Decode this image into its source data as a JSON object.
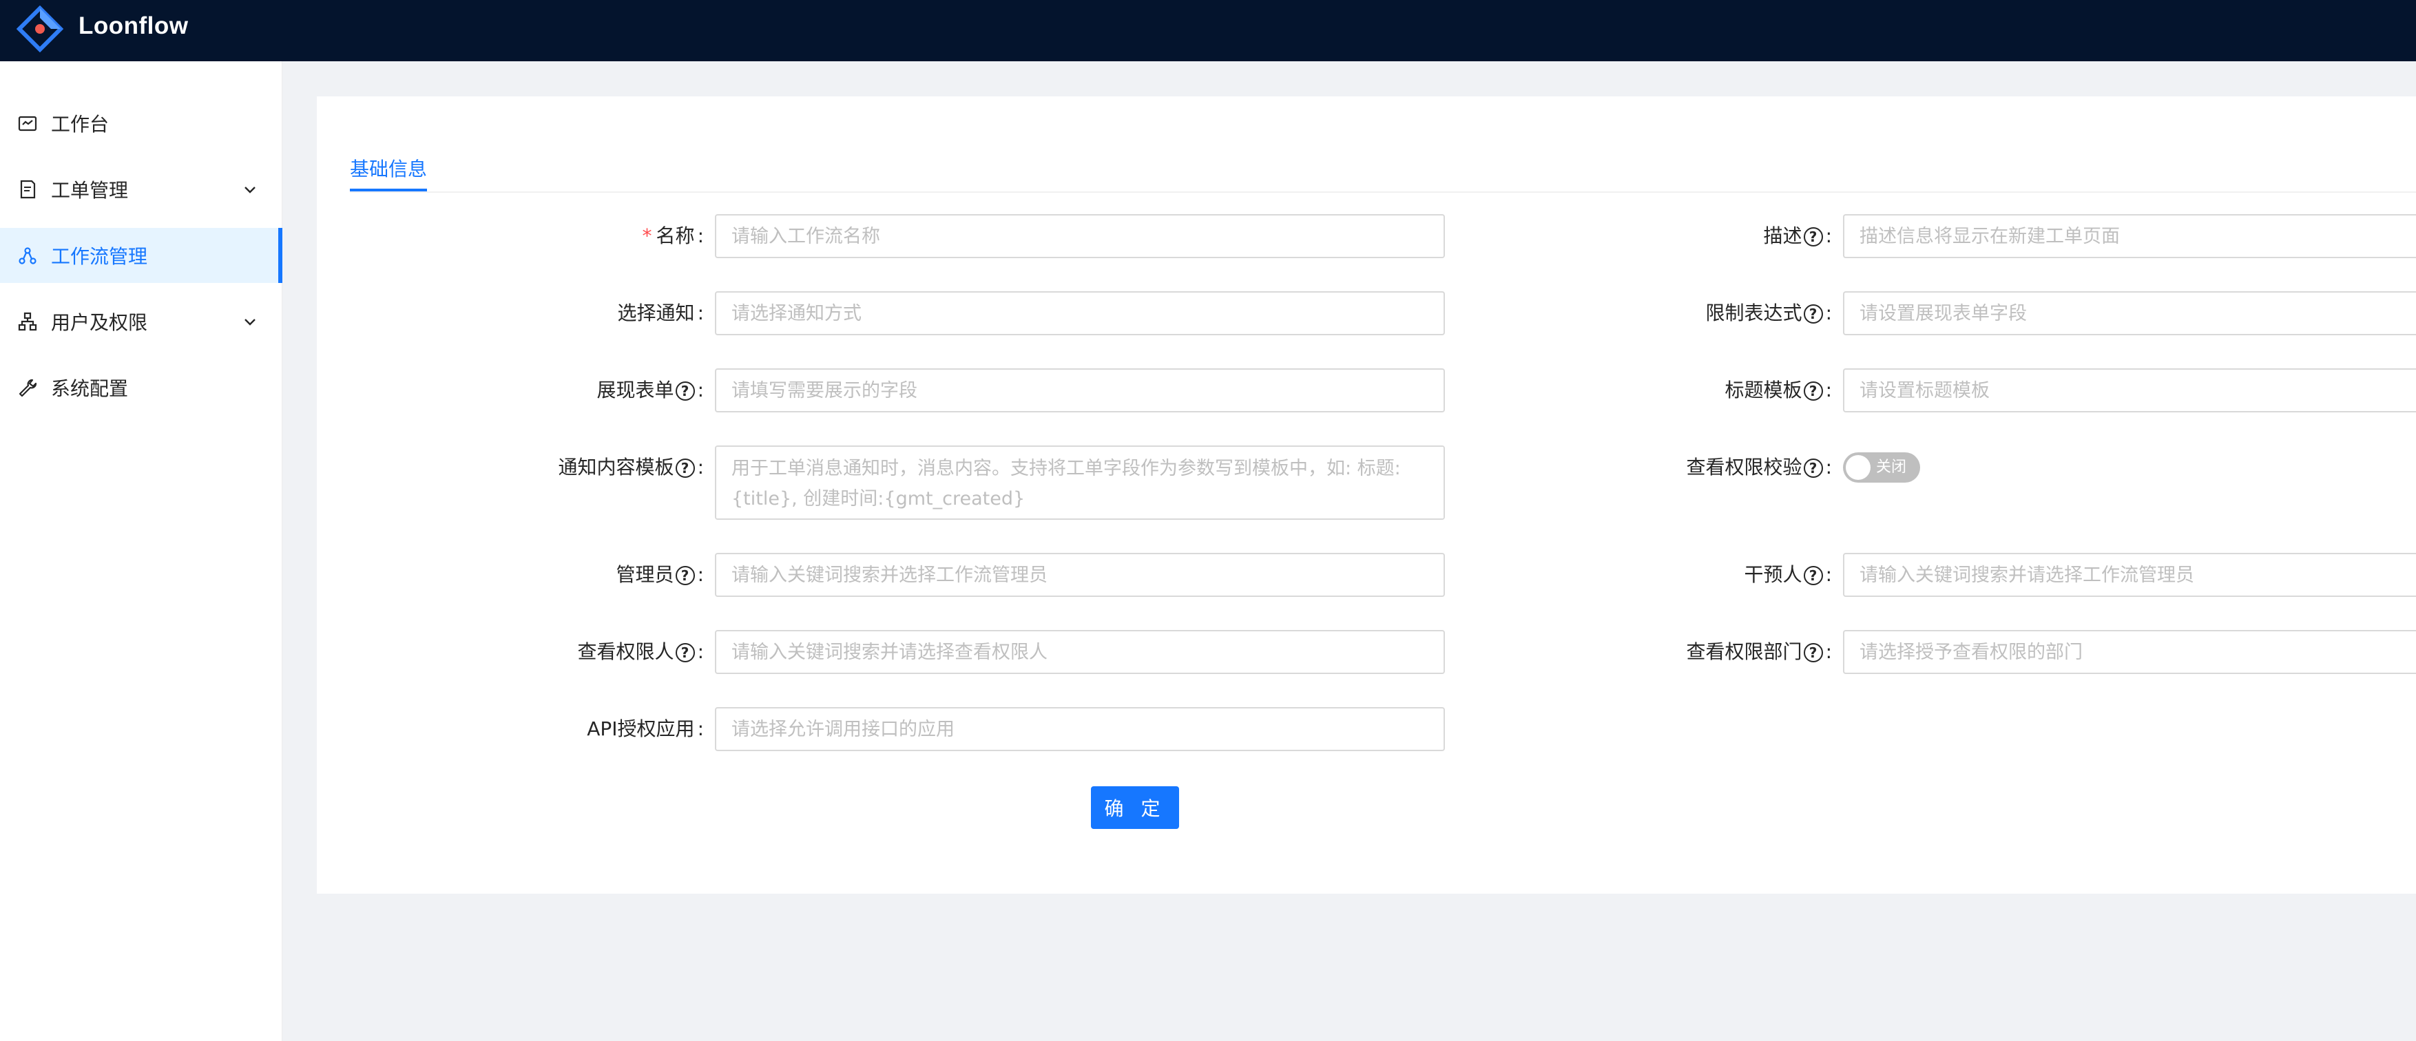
{
  "app": {
    "brand": "Loonflow"
  },
  "sidebar": {
    "items": [
      {
        "label": "工作台",
        "icon": "dashboard-icon"
      },
      {
        "label": "工单管理",
        "icon": "ticket-icon",
        "expandable": true
      },
      {
        "label": "工作流管理",
        "icon": "workflow-icon",
        "active": true
      },
      {
        "label": "用户及权限",
        "icon": "org-icon",
        "expandable": true
      },
      {
        "label": "系统配置",
        "icon": "wrench-icon"
      }
    ]
  },
  "main": {
    "tab": "基础信息",
    "form": {
      "name": {
        "label": "名称",
        "placeholder": "请输入工作流名称",
        "required": true
      },
      "description": {
        "label": "描述",
        "placeholder": "描述信息将显示在新建工单页面"
      },
      "notify": {
        "label": "选择通知",
        "placeholder": "请选择通知方式"
      },
      "limit_expression": {
        "label": "限制表达式",
        "placeholder": "请设置展现表单字段"
      },
      "display_form": {
        "label": "展现表单",
        "placeholder": "请填写需要展示的字段"
      },
      "title_template": {
        "label": "标题模板",
        "placeholder": "请设置标题模板"
      },
      "notify_template": {
        "label": "通知内容模板",
        "placeholder": "用于工单消息通知时，消息内容。支持将工单字段作为参数写到模板中，如: 标题:{title}, 创建时间:{gmt_created}"
      },
      "view_check": {
        "label": "查看权限校验",
        "switch_text": "关闭",
        "value": false
      },
      "admin": {
        "label": "管理员",
        "placeholder": "请输入关键词搜索并选择工作流管理员"
      },
      "intervener": {
        "label": "干预人",
        "placeholder": "请输入关键词搜索并请选择工作流管理员"
      },
      "view_persons": {
        "label": "查看权限人",
        "placeholder": "请输入关键词搜索并请选择查看权限人"
      },
      "view_depts": {
        "label": "查看权限部门",
        "placeholder": "请选择授予查看权限的部门"
      },
      "api_apps": {
        "label": "API授权应用",
        "placeholder": "请选择允许调用接口的应用"
      },
      "submit_label": "确 定"
    }
  },
  "colors": {
    "header_bg": "#04142d",
    "accent": "#1677ff",
    "active_bg": "#e6f4ff",
    "page_bg": "#f0f2f5"
  }
}
